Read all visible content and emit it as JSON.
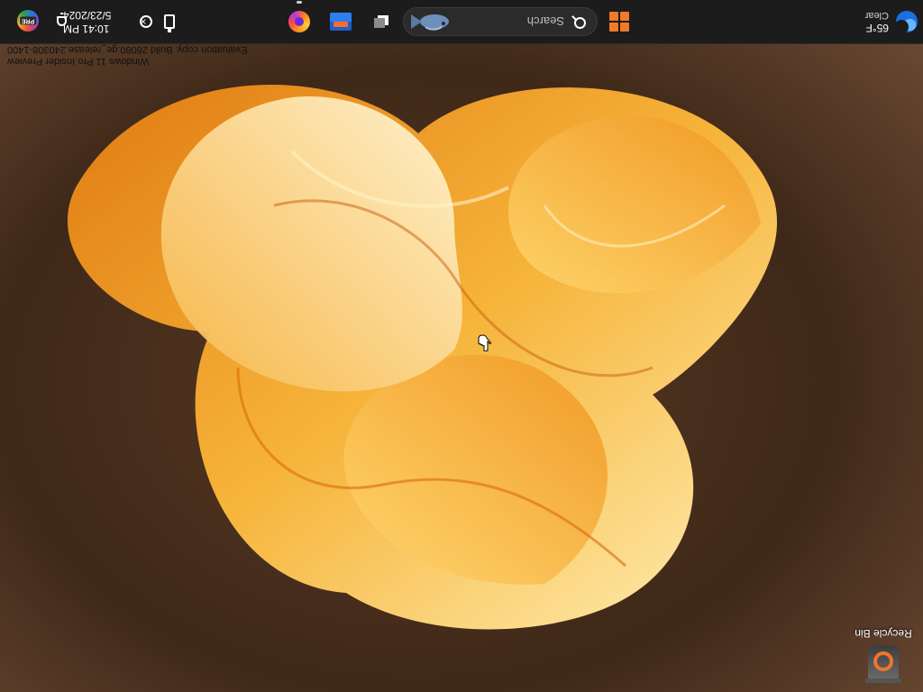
{
  "taskbar": {
    "weather": {
      "temp": "65°F",
      "condition": "Clear",
      "icon": "weather-moon-icon"
    },
    "start": {
      "icon": "windows-start-icon"
    },
    "search": {
      "placeholder": "Search",
      "icon": "search-icon"
    },
    "pinned": [
      {
        "name": "task-view",
        "icon": "task-view-icon"
      },
      {
        "name": "file-explorer",
        "icon": "folder-icon"
      },
      {
        "name": "firefox",
        "icon": "firefox-icon",
        "running": true
      }
    ],
    "tray": {
      "usb_icon": "usb-eject-icon",
      "network_icon": "network-disconnected-icon",
      "time": "10:41 PM",
      "date": "5/23/2024",
      "bell_icon": "notification-bell-icon",
      "pre_badge": "PRE"
    }
  },
  "desktop": {
    "recycle_bin_label": "Recycle Bin",
    "watermark": {
      "line1": "Windows 11 Pro Insider Preview",
      "line2": "Evaluation copy. Build 26080.ge_release.240308-1400"
    }
  },
  "colors": {
    "taskbar_bg": "#1c1c1c",
    "accent": "#f07a2a",
    "wallpaper_bg": "#3a2418"
  }
}
